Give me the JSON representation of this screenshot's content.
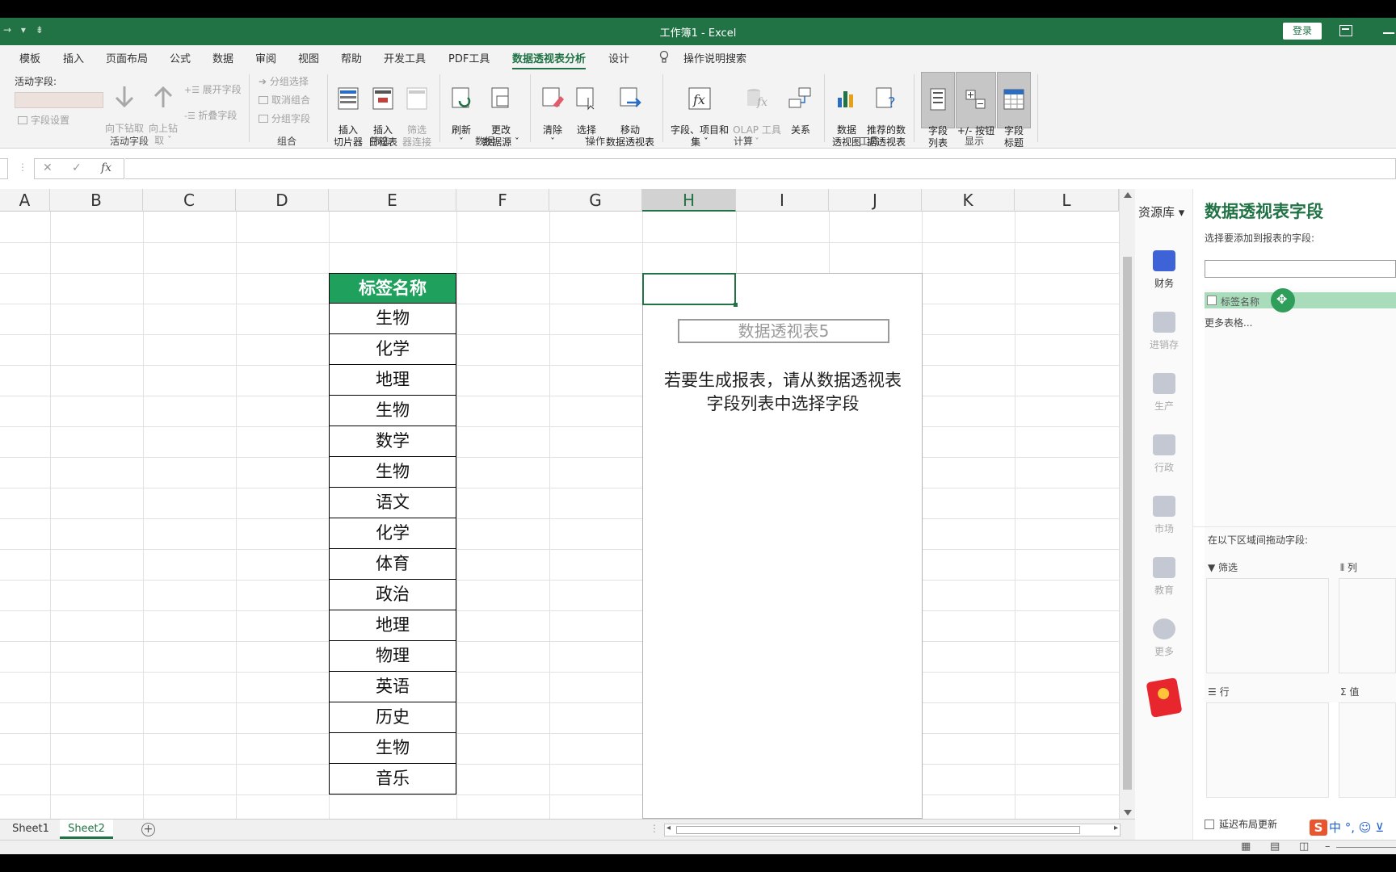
{
  "titlebar": {
    "title": "工作簿1  -  Excel",
    "login": "登录",
    "qat": "→ ▾   ⇟"
  },
  "tabs": [
    "模板",
    "插入",
    "页面布局",
    "公式",
    "数据",
    "审阅",
    "视图",
    "帮助",
    "开发工具",
    "PDF工具",
    "数据透视表分析",
    "设计"
  ],
  "active_tab": "数据透视表分析",
  "tell_me": "操作说明搜索",
  "ribbon": {
    "active_field": {
      "label": "活动字段:",
      "field_settings": "字段设置",
      "drill_down": "向下钻取",
      "drill_up": "向上钻\n取 ˇ",
      "expand_field": "展开字段",
      "collapse_field": "折叠字段",
      "group_label": "活动字段"
    },
    "group": {
      "group_selection": "分组选择",
      "ungroup": "取消组合",
      "group_field": "分组字段",
      "group_label": "组合"
    },
    "filter": {
      "insert_slicer": "插入\n切片器",
      "insert_timeline": "插入\n日程表",
      "filter_connections": "筛选\n器连接",
      "group_label": "筛选"
    },
    "data": {
      "refresh": "刷新\nˇ",
      "change_source": "更改\n数据源 ˇ",
      "group_label": "数据"
    },
    "actions": {
      "clear": "清除\nˇ",
      "select": "选择\nˇ",
      "move": "移动\n数据透视表",
      "group_label": "操作"
    },
    "calculations": {
      "fields_items": "字段、项目和\n集 ˇ",
      "olap": "OLAP 工具\nˇ",
      "relationships": "关系",
      "group_label": "计算"
    },
    "tools": {
      "pivot_chart": "数据\n透视图",
      "recommended": "推荐的数\n据透视表",
      "group_label": "工具"
    },
    "show": {
      "field_list": "字段\n列表",
      "buttons": "+/- 按钮",
      "headers": "字段\n标题",
      "group_label": "显示"
    }
  },
  "formula_bar": {
    "cancel": "✕",
    "enter": "✓",
    "fx": "fx",
    "value": ""
  },
  "grid": {
    "columns": [
      "A",
      "B",
      "C",
      "D",
      "E",
      "F",
      "G",
      "H",
      "I",
      "J",
      "K",
      "L"
    ],
    "selected_column": "H",
    "column_e": [
      "标签名称",
      "生物",
      "化学",
      "地理",
      "生物",
      "数学",
      "生物",
      "语文",
      "化学",
      "体育",
      "政治",
      "地理",
      "物理",
      "英语",
      "历史",
      "生物",
      "音乐"
    ],
    "pivot_name": "数据透视表5",
    "pivot_instruction": "若要生成报表，请从数据透视表\n字段列表中选择字段",
    "header_fill": "#1fa15d"
  },
  "sheets": [
    "Sheet1",
    "Sheet2"
  ],
  "active_sheet": "Sheet2",
  "resource_panel": {
    "title": "资源库 ▾",
    "items": [
      "财务",
      "进销存",
      "生产",
      "行政",
      "市场",
      "教育",
      "更多"
    ],
    "active_item": "财务"
  },
  "field_pane": {
    "title": "数据透视表字段",
    "subtitle": "选择要添加到报表的字段:",
    "search_value": "",
    "field": "标签名称",
    "more_tables": "更多表格...",
    "drag_label": "在以下区域间拖动字段:",
    "areas": {
      "filters": "筛选",
      "columns": "列",
      "rows": "行",
      "values": "值"
    },
    "defer_update": "延迟布局更新",
    "ime": "中 °, ☺ ⊻"
  },
  "colors": {
    "excel_green": "#217346",
    "table_header": "#1fa15d",
    "field_highlight": "#a9dcbb"
  }
}
